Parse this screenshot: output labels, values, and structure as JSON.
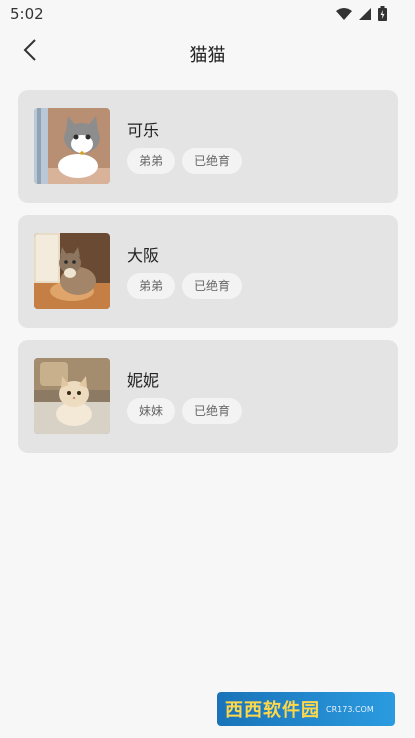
{
  "status": {
    "time": "5:02"
  },
  "header": {
    "title": "猫猫"
  },
  "cats": [
    {
      "name": "可乐",
      "tags": [
        "弟弟",
        "已绝育"
      ]
    },
    {
      "name": "大阪",
      "tags": [
        "弟弟",
        "已绝育"
      ]
    },
    {
      "name": "妮妮",
      "tags": [
        "妹妹",
        "已绝育"
      ]
    }
  ],
  "watermark": {
    "text": "西西软件园",
    "sub": "CR173.COM"
  }
}
